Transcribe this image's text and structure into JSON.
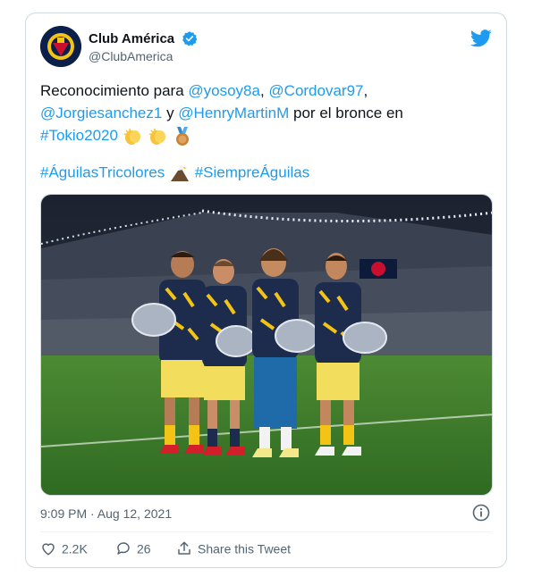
{
  "account": {
    "display_name": "Club América",
    "handle": "@ClubAmerica"
  },
  "tweet": {
    "text_1": "Reconocimiento para ",
    "mention_1": "@yosoy8a",
    "sep_1": ", ",
    "mention_2": "@Cordovar97",
    "sep_2": ",",
    "mention_3": "@Jorgiesanchez1",
    "text_2": " y ",
    "mention_4": "@HenryMartinM",
    "text_3": " por el bronce en",
    "hashtag_1": "#Tokio2020",
    "hashtag_2": "#ÁguilasTricolores",
    "hashtag_3": "#SiempreÁguilas",
    "timestamp": "9:09 PM · Aug 12, 2021"
  },
  "actions": {
    "likes": "2.2K",
    "replies": "26",
    "share_label": "Share this Tweet"
  },
  "colors": {
    "link": "#1d9bf0",
    "muted": "#536471",
    "pitch": "#3f7f2c"
  },
  "icons": [
    "verified-badge-icon",
    "twitter-bird-icon",
    "clapping-hands-icon",
    "bronze-medal-icon",
    "eagle-icon",
    "info-icon",
    "heart-icon",
    "reply-icon",
    "share-icon"
  ]
}
